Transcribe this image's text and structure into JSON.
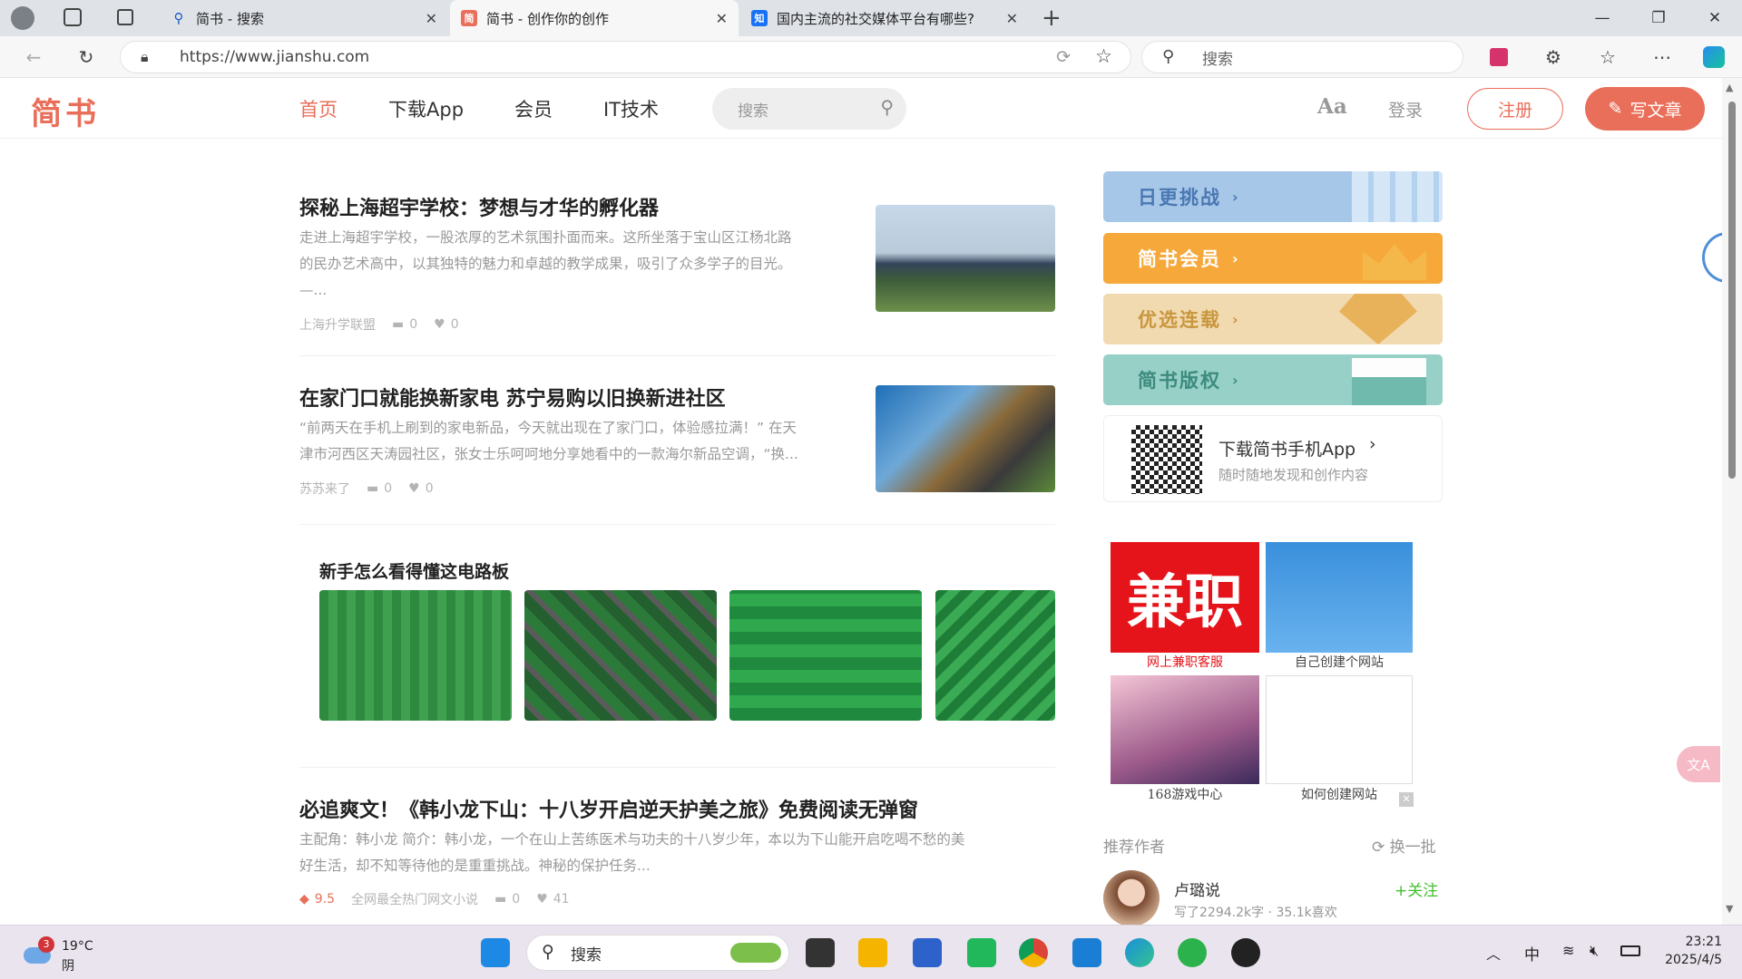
{
  "tabs": [
    {
      "title": "简书 - 搜索",
      "icon": "search-icon"
    },
    {
      "title": "简书 - 创作你的创作",
      "icon": "简"
    },
    {
      "title": "国内主流的社交媒体平台有哪些?",
      "icon": "知"
    }
  ],
  "address": {
    "url": "https://www.jianshu.com",
    "search_placeholder": "搜索"
  },
  "header": {
    "logo": "简书",
    "nav": [
      "首页",
      "下载App",
      "会员",
      "IT技术"
    ],
    "search_placeholder": "搜索",
    "aa": "Aa",
    "login": "登录",
    "register": "注册",
    "write": "写文章"
  },
  "articles": [
    {
      "title": "探秘上海超宇学校：梦想与才华的孵化器",
      "abstract": [
        "走进上海超宇学校，一股浓厚的艺术氛围扑面而来。这所坐落于宝山区江杨北路",
        "的民办艺术高中，以其独特的魅力和卓越的教学成果，吸引了众多学子的目光。",
        "—..."
      ],
      "author": "上海升学联盟",
      "comments": "0",
      "likes": "0"
    },
    {
      "title": "在家门口就能换新家电 苏宁易购以旧换新进社区",
      "abstract": [
        "“前两天在手机上刷到的家电新品，今天就出现在了家门口，体验感拉满！” 在天",
        "津市河西区天涛园社区，张女士乐呵呵地分享她看中的一款海尔新品空调，“换..."
      ],
      "author": "苏苏来了",
      "comments": "0",
      "likes": "0"
    },
    {
      "title": "必追爽文！《韩小龙下山：十八岁开启逆天护美之旅》免费阅读无弹窗",
      "abstract": [
        "主配角：韩小龙 简介：韩小龙，一个在山上苦练医术与功夫的十八岁少年，本以为下山能开启吃喝不愁的美",
        "好生活，却不知等待他的是重重挑战。神秘的保护任务..."
      ],
      "score": "9.5",
      "author": "全网最全热门网文小说",
      "comments": "0",
      "likes": "41"
    }
  ],
  "ad_block": {
    "title": "新手怎么看得懂这电路板"
  },
  "sidebar": {
    "banners": [
      "日更挑战",
      "简书会员",
      "优选连载",
      "简书版权"
    ],
    "app_title": "下载简书手机App",
    "app_sub": "随时随地发现和创作内容",
    "ads": [
      "网上兼职客服",
      "自己创建个网站",
      "168游戏中心",
      "如何创建网站"
    ],
    "ad_big_text": "兼职",
    "recommended": "推荐作者",
    "refresh": "换一批",
    "author": {
      "name": "卢璐说",
      "stats": "写了2294.2k字 · 35.1k喜欢",
      "follow": "+关注"
    }
  },
  "taskbar": {
    "temp": "19°C",
    "weather": "阴",
    "badge": "3",
    "search": "搜索",
    "ime": "中",
    "time": "23:21",
    "date": "2025/4/5"
  }
}
